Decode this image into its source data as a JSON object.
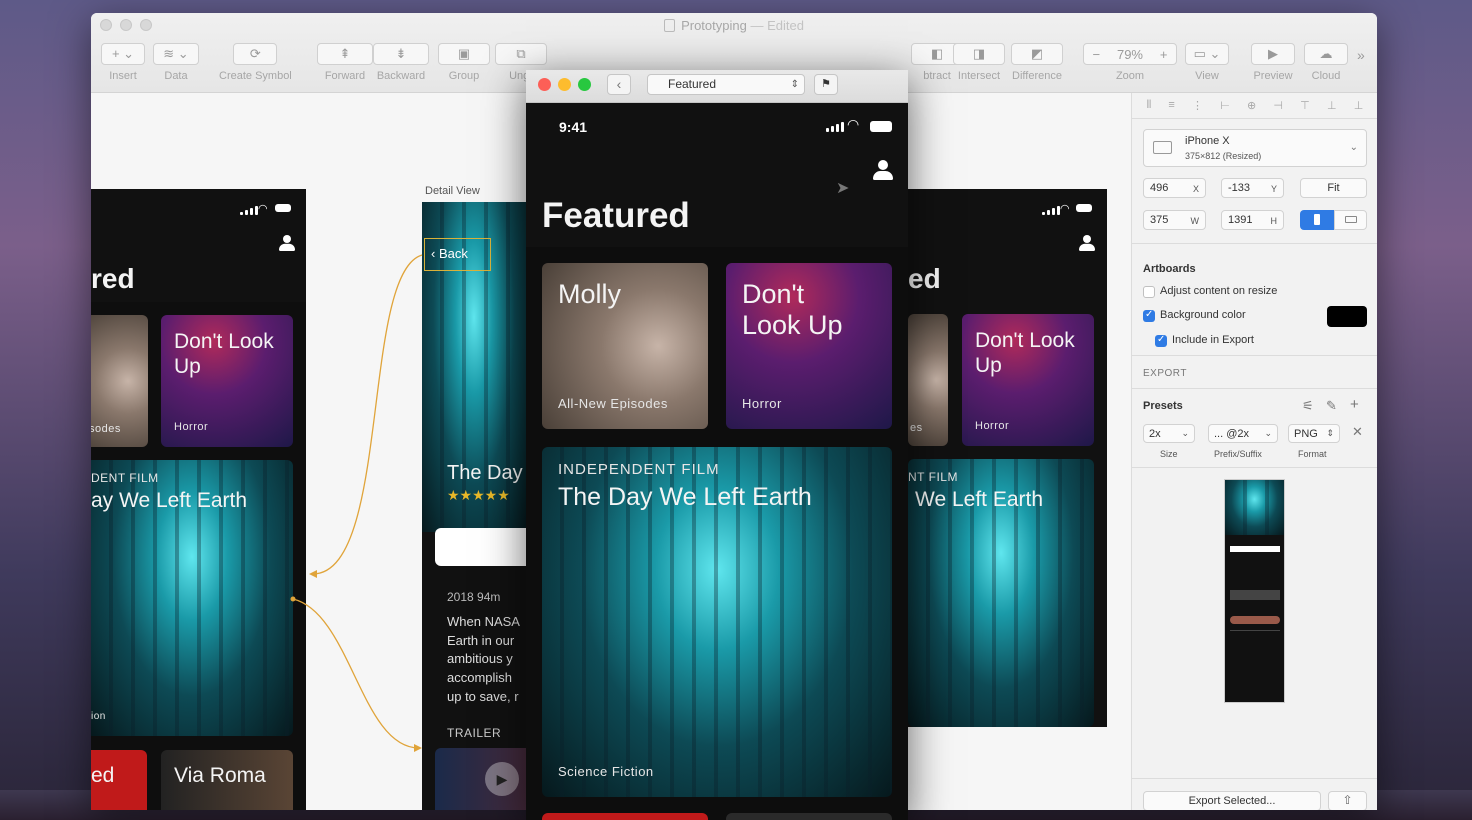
{
  "window": {
    "title": "Prototyping",
    "status": "— Edited"
  },
  "toolbar": {
    "insert": "Insert",
    "data": "Data",
    "create_symbol": "Create Symbol",
    "forward": "Forward",
    "backward": "Backward",
    "group": "Group",
    "ungroup": "Ungr",
    "subtract": "btract",
    "intersect": "Intersect",
    "difference": "Difference",
    "zoom": "Zoom",
    "zoom_value": "79%",
    "view": "View",
    "preview": "Preview",
    "cloud": "Cloud"
  },
  "canvas": {
    "detail_label": "Detail View",
    "left_board": {
      "title": "red",
      "dlu": "Don't Look Up",
      "dlu_genre": "Horror",
      "molly_sub": "sodes",
      "indep": "DENT FILM",
      "film": "ay We Left Earth",
      "fiction": "ion",
      "bottom_left": "ed",
      "via_roma": "Via Roma"
    },
    "detail": {
      "back": "Back",
      "title": "The Day",
      "stars": "★★★★★",
      "meta": "2018   94m",
      "desc_lines": [
        "When NASA",
        "Earth in our",
        "ambitious y",
        "accomplish",
        "up to save, r"
      ],
      "trailer": "TRAILER"
    },
    "right_board": {
      "title": "ed",
      "molly_sub": "es",
      "dlu": "Don't Look Up",
      "dlu_genre": "Horror",
      "indep": "NT FILM",
      "film": "We Left Earth"
    }
  },
  "preview": {
    "select_value": "Featured",
    "time": "9:41",
    "heading": "Featured",
    "molly": {
      "title": "Molly",
      "sub": "All-New Episodes"
    },
    "dlu": {
      "title_1": "Don't",
      "title_2": "Look Up",
      "genre": "Horror"
    },
    "feature": {
      "label": "INDEPENDENT FILM",
      "title": "The Day We Left Earth",
      "genre": "Science Fiction"
    }
  },
  "inspector": {
    "device_name": "iPhone X",
    "device_size": "375×812 (Resized)",
    "x": "496",
    "x_lbl": "X",
    "y": "-133",
    "y_lbl": "Y",
    "fit": "Fit",
    "w": "375",
    "w_lbl": "W",
    "h": "1391",
    "h_lbl": "H",
    "artboards": "Artboards",
    "adjust": "Adjust content on resize",
    "bg_color": "Background color",
    "include_export": "Include in Export",
    "export": "EXPORT",
    "presets": "Presets",
    "size_val": "2x",
    "prefix_val": "... @2x",
    "format_val": "PNG",
    "size_lbl": "Size",
    "prefix_lbl": "Prefix/Suffix",
    "format_lbl": "Format",
    "export_btn": "Export Selected...",
    "bg_swatch": "#000000"
  }
}
